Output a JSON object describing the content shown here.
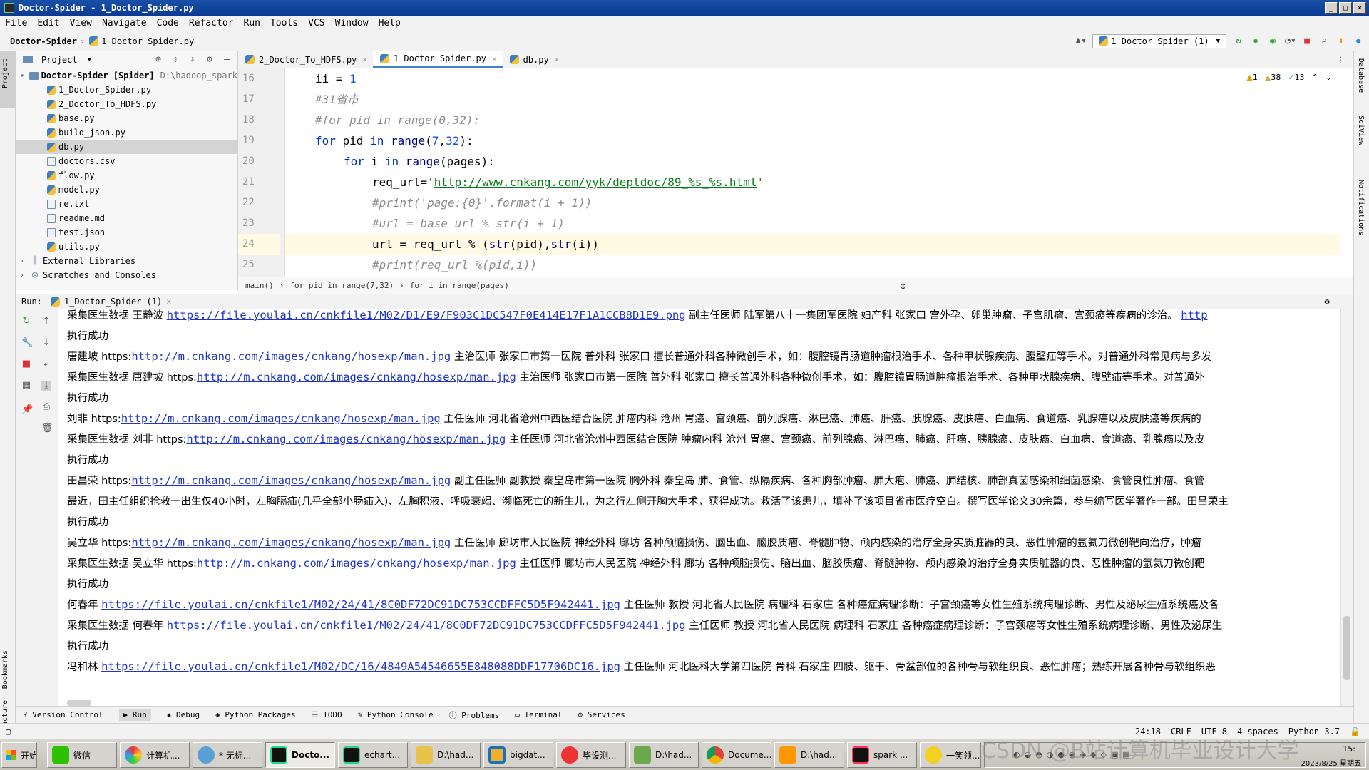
{
  "window": {
    "title": "Doctor-Spider - 1_Doctor_Spider.py"
  },
  "menu": [
    "File",
    "Edit",
    "View",
    "Navigate",
    "Code",
    "Refactor",
    "Run",
    "Tools",
    "VCS",
    "Window",
    "Help"
  ],
  "nav": {
    "project": "Doctor-Spider",
    "file": "1_Doctor_Spider.py",
    "run_config": "1_Doctor_Spider (1)"
  },
  "project_panel": {
    "title": "Project",
    "root": "Doctor-Spider [Spider]",
    "root_path": "D:\\hadoop_spark",
    "files": [
      "1_Doctor_Spider.py",
      "2_Doctor_To_HDFS.py",
      "base.py",
      "build_json.py",
      "db.py",
      "doctors.csv",
      "flow.py",
      "model.py",
      "re.txt",
      "readme.md",
      "test.json",
      "utils.py"
    ],
    "external": "External Libraries",
    "scratches": "Scratches and Consoles"
  },
  "tabs": [
    "2_Doctor_To_HDFS.py",
    "1_Doctor_Spider.py",
    "db.py"
  ],
  "warnings": {
    "a": "1",
    "b": "38",
    "c": "13"
  },
  "code": {
    "line_numbers": [
      "16",
      "17",
      "18",
      "19",
      "20",
      "21",
      "22",
      "23",
      "24",
      "25"
    ],
    "l16": {
      "a": "ii = ",
      "b": "1"
    },
    "l17": "#31省市",
    "l18": "#for pid in range(0,32):",
    "l19": {
      "kw": "for",
      "a": " pid ",
      "kw2": "in",
      "fn": " range",
      "b": "(",
      "n1": "7",
      "c": ",",
      "n2": "32",
      "d": "):"
    },
    "l20": {
      "kw": "for",
      "a": " i ",
      "kw2": "in",
      "fn": " range",
      "b": "(pages):"
    },
    "l21": {
      "a": "req_url=",
      "q1": "'",
      "url": "http://www.cnkang.com/yyk/deptdoc/89_%s_%s.html",
      "q2": "'"
    },
    "l22": "#print('page:{0}'.format(i + 1))",
    "l23": "#url = base_url % str(i + 1)",
    "l24": {
      "a": "url = req_url % (",
      "fn": "str",
      "b": "(pid),",
      "fn2": "str",
      "c": "(i))"
    },
    "l25": "#print(req_url %(pid,i))"
  },
  "breadcrumb": [
    "main()",
    "for pid in range(7,32)",
    "for i in range(pages)"
  ],
  "run": {
    "label": "Run:",
    "config": "1_Doctor_Spider (1)"
  },
  "console": [
    {
      "pre": "采集医生数据 王静波 ",
      "link": "https://file.youlai.cn/cnkfile1/M02/D1/E9/F903C1DC547F0E414E17F1A1CCB8D1E9.png",
      "post": " 副主任医师   陆军第八十一集团军医院 妇产科 张家口 宫外孕、卵巢肿瘤、子宫肌瘤、宫颈癌等疾病的诊治。 ",
      "post_link": "http"
    },
    {
      "pre": "执行成功"
    },
    {
      "pre": "唐建坡 https:",
      "link": "http://m.cnkang.com/images/cnkang/hosexp/man.jpg",
      "post": " 主治医师   张家口市第一医院 普外科 张家口 擅长普通外科各种微创手术，如：腹腔镜胃肠道肿瘤根治手术、各种甲状腺疾病、腹壁疝等手术。对普通外科常见病与多发"
    },
    {
      "pre": "采集医生数据 唐建坡 https:",
      "link": "http://m.cnkang.com/images/cnkang/hosexp/man.jpg",
      "post": " 主治医师   张家口市第一医院 普外科 张家口 擅长普通外科各种微创手术，如：腹腔镜胃肠道肿瘤根治手术、各种甲状腺疾病、腹壁疝等手术。对普通外"
    },
    {
      "pre": "执行成功"
    },
    {
      "pre": "刘非 https:",
      "link": "http://m.cnkang.com/images/cnkang/hosexp/man.jpg",
      "post": " 主任医师   河北省沧州中西医结合医院 肿瘤内科 沧州 胃癌、宫颈癌、前列腺癌、淋巴癌、肺癌、肝癌、胰腺癌、皮肤癌、白血病、食道癌、乳腺癌以及皮肤癌等疾病的"
    },
    {
      "pre": "采集医生数据 刘非 https:",
      "link": "http://m.cnkang.com/images/cnkang/hosexp/man.jpg",
      "post": " 主任医师   河北省沧州中西医结合医院 肿瘤内科 沧州 胃癌、宫颈癌、前列腺癌、淋巴癌、肺癌、肝癌、胰腺癌、皮肤癌、白血病、食道癌、乳腺癌以及皮"
    },
    {
      "pre": "执行成功"
    },
    {
      "pre": "田昌荣 https:",
      "link": "http://m.cnkang.com/images/cnkang/hosexp/man.jpg",
      "post": " 副主任医师  副教授 秦皇岛市第一医院 胸外科 秦皇岛 肺、食管、纵隔疾病、各种胸部肿瘤、肺大疱、肺癌、肺结核、肺部真菌感染和细菌感染、食管良性肿瘤、食管"
    },
    {
      "pre": "最近，田主任组织抢救一出生仅40小时，左胸膈疝(几乎全部小肠疝入)、左胸积液、呼吸衰竭、濒临死亡的新生儿，为之行左侧开胸大手术，获得成功。救活了该患儿，填补了该项目省市医疗空白。撰写医学论文30余篇，参与编写医学著作一部。田昌荣主"
    },
    {
      "pre": "执行成功"
    },
    {
      "pre": "吴立华 https:",
      "link": "http://m.cnkang.com/images/cnkang/hosexp/man.jpg",
      "post": " 主任医师   廊坊市人民医院 神经外科 廊坊 各种颅脑损伤、脑出血、脑胶质瘤、脊髓肿物、颅内感染的治疗全身实质脏器的良、恶性肿瘤的氩氦刀微创靶向治疗，肿瘤"
    },
    {
      "pre": "采集医生数据 吴立华 https:",
      "link": "http://m.cnkang.com/images/cnkang/hosexp/man.jpg",
      "post": " 主任医师   廊坊市人民医院 神经外科 廊坊 各种颅脑损伤、脑出血、脑胶质瘤、脊髓肿物、颅内感染的治疗全身实质脏器的良、恶性肿瘤的氩氦刀微创靶"
    },
    {
      "pre": "执行成功"
    },
    {
      "pre": "何春年 ",
      "link": "https://file.youlai.cn/cnkfile1/M02/24/41/8C0DF72DC91DC753CCDFFC5D5F942441.jpg",
      "post": " 主任医师  教授 河北省人民医院 病理科 石家庄 各种癌症病理诊断：子宫颈癌等女性生殖系统病理诊断、男性及泌尿生殖系统癌及各"
    },
    {
      "pre": "采集医生数据 何春年 ",
      "link": "https://file.youlai.cn/cnkfile1/M02/24/41/8C0DF72DC91DC753CCDFFC5D5F942441.jpg",
      "post": " 主任医师  教授 河北省人民医院 病理科 石家庄 各种癌症病理诊断：子宫颈癌等女性生殖系统病理诊断、男性及泌尿生"
    },
    {
      "pre": "执行成功"
    },
    {
      "pre": "冯和林 ",
      "link": "https://file.youlai.cn/cnkfile1/M02/DC/16/4849A54546655E848088DDF17706DC16.jpg",
      "post": " 主任医师   河北医科大学第四医院 骨科 石家庄 四肢、躯干、骨盆部位的各种骨与软组织良、恶性肿瘤；熟练开展各种骨与软组织恶"
    }
  ],
  "bottom_tabs": [
    "Version Control",
    "Run",
    "Debug",
    "Python Packages",
    "TODO",
    "Python Console",
    "Problems",
    "Terminal",
    "Services"
  ],
  "status": {
    "pos": "24:18",
    "crlf": "CRLF",
    "enc": "UTF-8",
    "indent": "4 spaces",
    "interp": "Python 3.7"
  },
  "taskbar": {
    "start": "开始",
    "items": [
      "微信",
      "计算机...",
      "* 无标...",
      "Docto...",
      "echart...",
      "D:\\had...",
      "bigdat...",
      "毕设测...",
      "D:\\had...",
      "Docume...",
      "D:\\had...",
      "spark ...",
      "一笑领..."
    ],
    "time": "15:",
    "date": "2023/8/25 星期五"
  },
  "watermark": "CSDN @B站计算机毕业设计大学",
  "colors": {
    "accent": "#4083c9",
    "link": "#2136c8",
    "string": "#067d17",
    "keyword": "#0033b3"
  }
}
